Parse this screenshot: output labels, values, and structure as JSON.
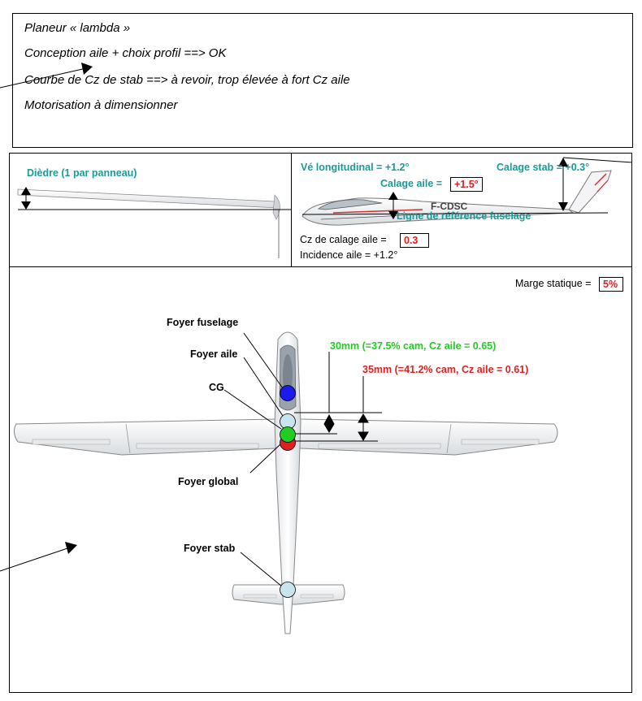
{
  "notes": {
    "line1": "Planeur « lambda »",
    "line2": "Conception aile + choix profil ==> OK",
    "line3": "Courbe de Cz de stab ==> à revoir, trop élevée à fort Cz aile",
    "line4": "Motorisation à dimensionner"
  },
  "front_view": {
    "dihedral_label": "Dièdre (1 par panneau)"
  },
  "side_view": {
    "ve_longitudinal": "Vé longitudinal = +1.2°",
    "calage_stab": "Calage stab = +0.3°",
    "calage_aile_label": "Calage aile = ",
    "calage_aile_value": "+1.5°",
    "reference_line": "Ligne de référence fuselage",
    "cz_calage_label": "Cz de calage aile  = ",
    "cz_calage_value": "0.3",
    "incidence": "Incidence aile = +1.2°",
    "registration": "F-CDSC"
  },
  "top_view": {
    "marge_label": "Marge statique = ",
    "marge_value": "5%",
    "foyer_fuselage": "Foyer fuselage",
    "foyer_aile": "Foyer aile",
    "cg": "CG",
    "foyer_global": "Foyer global",
    "foyer_stab": "Foyer stab",
    "dim_30": "30mm (=37.5% cam, Cz aile = 0.65)",
    "dim_35": "35mm (=41.2% cam, Cz aile = 0.61)"
  },
  "colors": {
    "teal": "#1a9a9a",
    "red": "#e02020",
    "green": "#22cc22",
    "blue": "#1a1aee",
    "light_blue": "#c8e4ec"
  }
}
